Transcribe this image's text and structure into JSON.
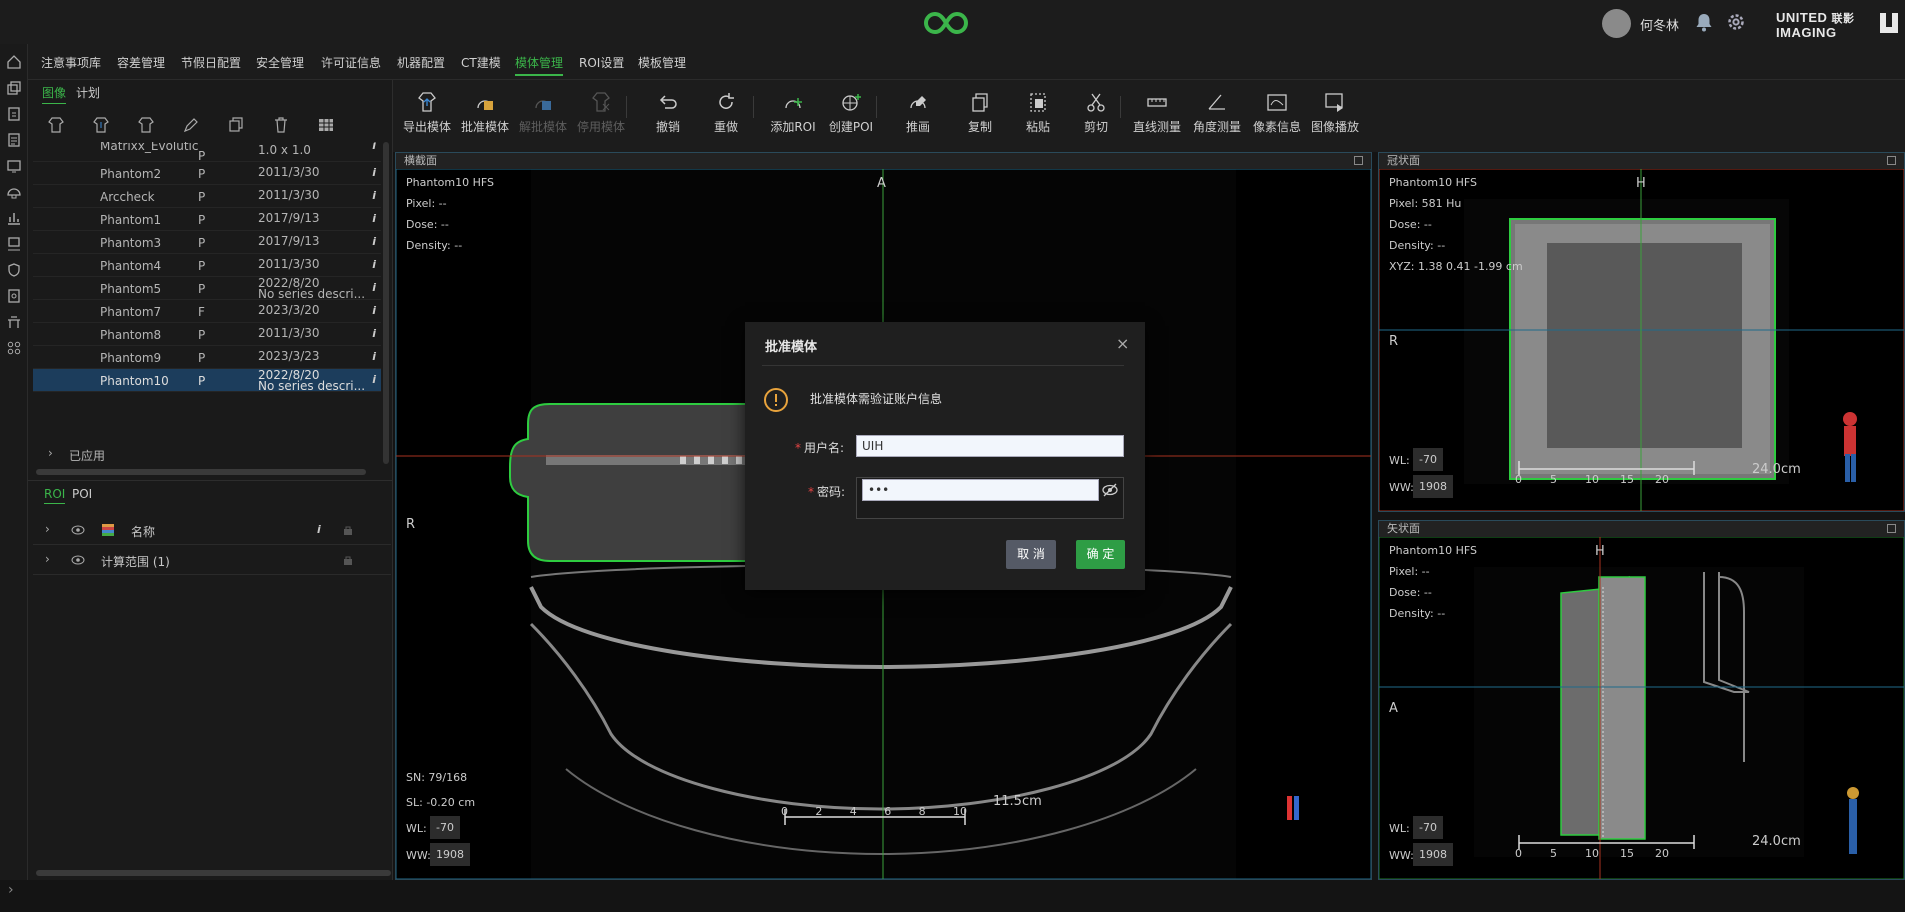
{
  "header": {
    "user_name": "何冬林",
    "brand_line1": "UNITED",
    "brand_line1_cn": "联影",
    "brand_line2": "IMAGING",
    "icons": [
      "logo-icon",
      "bell-icon",
      "gear-icon",
      "brand-mark-icon"
    ]
  },
  "menu": {
    "items": [
      "注意事项库",
      "容差管理",
      "节假日配置",
      "安全管理",
      "许可证信息",
      "机器配置",
      "CT建模",
      "模体管理",
      "ROI设置",
      "模板管理"
    ],
    "active_index": 7
  },
  "left_panel": {
    "tabs": [
      "图像",
      "计划"
    ],
    "active_tab": 0,
    "phantoms": [
      {
        "name": "Matrixx_Evolutic",
        "type": "P",
        "info": "1.0 x 1.0",
        "info2": ""
      },
      {
        "name": "Phantom2",
        "type": "P",
        "info": "2011/3/30",
        "info2": ""
      },
      {
        "name": "Arccheck",
        "type": "P",
        "info": "2011/3/30",
        "info2": ""
      },
      {
        "name": "Phantom1",
        "type": "P",
        "info": "2017/9/13",
        "info2": ""
      },
      {
        "name": "Phantom3",
        "type": "P",
        "info": "2017/9/13",
        "info2": ""
      },
      {
        "name": "Phantom4",
        "type": "P",
        "info": "2011/3/30",
        "info2": ""
      },
      {
        "name": "Phantom5",
        "type": "P",
        "info": "2022/8/20",
        "info2": "No series descri..."
      },
      {
        "name": "Phantom7",
        "type": "F",
        "info": "2023/3/20",
        "info2": ""
      },
      {
        "name": "Phantom8",
        "type": "P",
        "info": "2011/3/30",
        "info2": ""
      },
      {
        "name": "Phantom9",
        "type": "P",
        "info": "2023/3/23",
        "info2": ""
      },
      {
        "name": "Phantom10",
        "type": "P",
        "info": "2022/8/20",
        "info2": "No series descri...",
        "selected": true
      }
    ],
    "applied_label": "已应用",
    "roi_tabs": [
      "ROI",
      "POI"
    ],
    "roi_header_name": "名称",
    "roi_rows": [
      "计算范围 (1)"
    ]
  },
  "toolbar": {
    "buttons": [
      {
        "label": "导出模体",
        "enabled": true
      },
      {
        "label": "批准模体",
        "enabled": true
      },
      {
        "label": "解批模体",
        "enabled": false
      },
      {
        "label": "停用模体",
        "enabled": false
      },
      {
        "label": "撤销",
        "enabled": true
      },
      {
        "label": "重做",
        "enabled": true
      },
      {
        "label": "添加ROI",
        "enabled": true
      },
      {
        "label": "创建POI",
        "enabled": true
      },
      {
        "label": "推画",
        "enabled": true
      },
      {
        "label": "复制",
        "enabled": true
      },
      {
        "label": "粘贴",
        "enabled": true
      },
      {
        "label": "剪切",
        "enabled": true
      },
      {
        "label": "直线测量",
        "enabled": true
      },
      {
        "label": "角度测量",
        "enabled": true
      },
      {
        "label": "像素信息",
        "enabled": true
      },
      {
        "label": "图像播放",
        "enabled": true
      }
    ]
  },
  "viewports": {
    "axial": {
      "title": "横截面",
      "series": "Phantom10 HFS",
      "pixel": "Pixel:  --",
      "dose": "Dose:  --",
      "density": "Density:  --",
      "top_label": "A",
      "left_label": "R",
      "sn": "SN: 79/168",
      "sl": "SL: -0.20 cm",
      "wl_label": "WL:",
      "wl": "-70",
      "ww_label": "WW:",
      "ww": "1908",
      "scale_ticks": [
        "0",
        "2",
        "4",
        "6",
        "8",
        "10"
      ],
      "scale_label": "11.5cm"
    },
    "coronal": {
      "title": "冠状面",
      "series": "Phantom10 HFS",
      "pixel": "Pixel:  581 Hu",
      "dose": "Dose:  --",
      "density": "Density:  --",
      "xyz": "XYZ: 1.38 0.41 -1.99 cm",
      "top_label": "H",
      "left_label": "R",
      "wl_label": "WL:",
      "wl": "-70",
      "ww_label": "WW:",
      "ww": "1908",
      "scale_ticks": [
        "0",
        "5",
        "10",
        "15",
        "20"
      ],
      "scale_label": "24.0cm"
    },
    "sagittal": {
      "title": "矢状面",
      "series": "Phantom10 HFS",
      "pixel": "Pixel:  --",
      "dose": "Dose:  --",
      "density": "Density:  --",
      "top_label": "H",
      "left_label": "A",
      "wl_label": "WL:",
      "wl": "-70",
      "ww_label": "WW:",
      "ww": "1908",
      "scale_ticks": [
        "0",
        "5",
        "10",
        "15",
        "20"
      ],
      "scale_label": "24.0cm"
    }
  },
  "dialog": {
    "title": "批准模体",
    "message": "批准模体需验证账户信息",
    "username_label": "用户名:",
    "username_value": "UIH",
    "password_label": "密码:",
    "password_value": "•••",
    "cancel": "取 消",
    "ok": "确 定"
  },
  "colors": {
    "accent": "#3bb54a",
    "selection": "#1c3d5c",
    "contour": "#2ecc40",
    "crosshair_green": "#3aa13a",
    "crosshair_red": "#a8321f",
    "crosshair_blue": "#1f6a8a"
  }
}
